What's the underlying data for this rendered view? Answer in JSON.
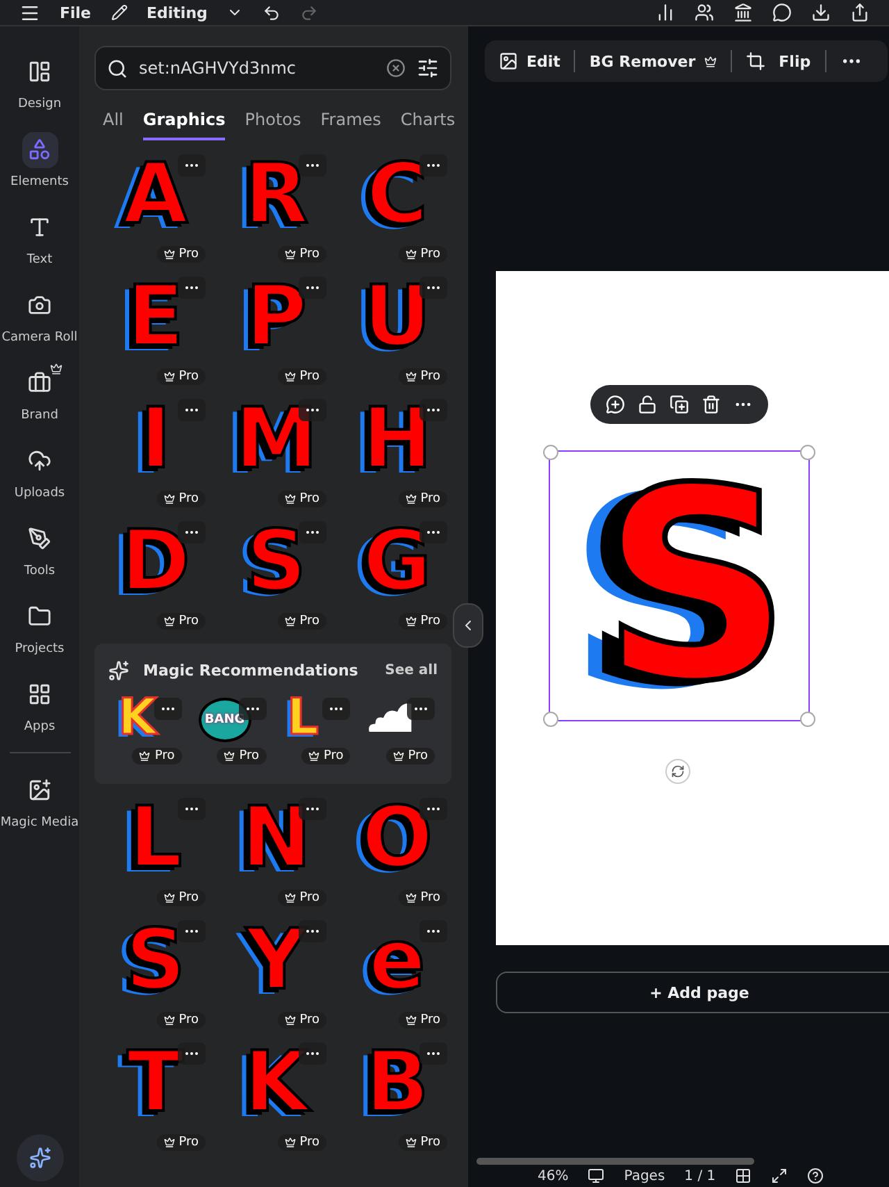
{
  "top_bar": {
    "menu_label": "File",
    "mode_label": "Editing"
  },
  "rail": [
    {
      "label": "Design",
      "selected": false,
      "crown": false
    },
    {
      "label": "Elements",
      "selected": true,
      "crown": false
    },
    {
      "label": "Text",
      "selected": false,
      "crown": false
    },
    {
      "label": "Camera Roll",
      "selected": false,
      "crown": false
    },
    {
      "label": "Brand",
      "selected": false,
      "crown": true
    },
    {
      "label": "Uploads",
      "selected": false,
      "crown": false
    },
    {
      "label": "Tools",
      "selected": false,
      "crown": false
    },
    {
      "label": "Projects",
      "selected": false,
      "crown": false
    },
    {
      "label": "Apps",
      "selected": false,
      "crown": false
    },
    {
      "label": "Magic Media",
      "selected": false,
      "crown": false
    }
  ],
  "search": {
    "value": "set:nAGHVYd3nmc"
  },
  "tabs": [
    {
      "label": "All",
      "selected": false
    },
    {
      "label": "Graphics",
      "selected": true
    },
    {
      "label": "Photos",
      "selected": false
    },
    {
      "label": "Frames",
      "selected": false
    },
    {
      "label": "Charts",
      "selected": false
    }
  ],
  "graphics_top": [
    {
      "letter": "A",
      "badge": "Pro"
    },
    {
      "letter": "R",
      "badge": "Pro"
    },
    {
      "letter": "C",
      "badge": "Pro"
    },
    {
      "letter": "E",
      "badge": "Pro"
    },
    {
      "letter": "P",
      "badge": "Pro"
    },
    {
      "letter": "U",
      "badge": "Pro"
    },
    {
      "letter": "I",
      "badge": "Pro"
    },
    {
      "letter": "M",
      "badge": "Pro"
    },
    {
      "letter": "H",
      "badge": "Pro"
    },
    {
      "letter": "D",
      "badge": "Pro"
    },
    {
      "letter": "S",
      "badge": "Pro"
    },
    {
      "letter": "G",
      "badge": "Pro"
    }
  ],
  "recommendations": {
    "title": "Magic Recommendations",
    "link": "See all",
    "items": [
      {
        "kind": "letter",
        "text": "K",
        "badge": "Pro"
      },
      {
        "kind": "bubble",
        "text": "BANG",
        "badge": "Pro"
      },
      {
        "kind": "letter",
        "text": "L",
        "badge": "Pro"
      },
      {
        "kind": "cloud",
        "badge": "Pro"
      }
    ]
  },
  "graphics_bottom": [
    {
      "letter": "L",
      "badge": "Pro"
    },
    {
      "letter": "N",
      "badge": "Pro"
    },
    {
      "letter": "O",
      "badge": "Pro"
    },
    {
      "letter": "S",
      "badge": "Pro"
    },
    {
      "letter": "Y",
      "badge": "Pro"
    },
    {
      "letter": "e",
      "badge": "Pro"
    },
    {
      "letter": "T",
      "badge": "Pro"
    },
    {
      "letter": "K",
      "badge": "Pro"
    },
    {
      "letter": "B",
      "badge": "Pro"
    }
  ],
  "context_toolbar": {
    "edit": "Edit",
    "bg_remover": "BG Remover",
    "flip": "Flip"
  },
  "canvas": {
    "letter": "S"
  },
  "add_page": "+ Add page",
  "footer": {
    "zoom": "46%",
    "pages": "Pages",
    "page_count": "1 / 1"
  }
}
